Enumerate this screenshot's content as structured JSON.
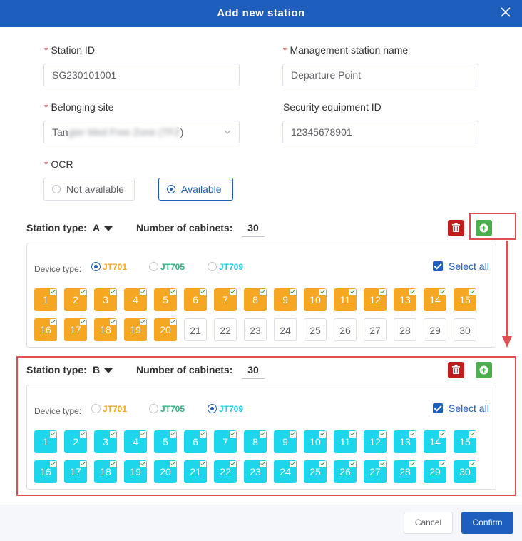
{
  "dialog": {
    "title": "Add new station",
    "close_icon": "close-icon"
  },
  "form": {
    "required_mark": "*",
    "station_id": {
      "label": "Station ID",
      "value": "SG230101001"
    },
    "management_station_name": {
      "label": "Management station name",
      "value": "Departure Point"
    },
    "belonging_site": {
      "label": "Belonging site",
      "value_visible_prefix": "Tan",
      "value_obscured": "gier Med Free Zone (TFZ",
      "value_visible_suffix": ")",
      "icon": "chevron-down-icon"
    },
    "security_equipment_id": {
      "label": "Security equipment ID",
      "value": "12345678901"
    },
    "ocr": {
      "label": "OCR",
      "options": [
        {
          "label": "Not available",
          "selected": false
        },
        {
          "label": "Available",
          "selected": true
        }
      ]
    }
  },
  "stations": [
    {
      "station_type_label": "Station type:",
      "station_type_value": "A",
      "cabinets_label": "Number of cabinets:",
      "cabinets_value": "30",
      "device_type_label": "Device type:",
      "device_options": [
        {
          "label": "JT701",
          "selected": true,
          "color": "#f5a623"
        },
        {
          "label": "JT705",
          "selected": false,
          "color": "#2db37f"
        },
        {
          "label": "JT709",
          "selected": false,
          "color": "#1ec8e0"
        }
      ],
      "select_all_label": "Select all",
      "select_all_checked": true,
      "active_color": "#f5a623",
      "cabinets": [
        {
          "n": "1",
          "on": true
        },
        {
          "n": "2",
          "on": true
        },
        {
          "n": "3",
          "on": true
        },
        {
          "n": "4",
          "on": true
        },
        {
          "n": "5",
          "on": true
        },
        {
          "n": "6",
          "on": true
        },
        {
          "n": "7",
          "on": true
        },
        {
          "n": "8",
          "on": true
        },
        {
          "n": "9",
          "on": true
        },
        {
          "n": "10",
          "on": true
        },
        {
          "n": "11",
          "on": true
        },
        {
          "n": "12",
          "on": true
        },
        {
          "n": "13",
          "on": true
        },
        {
          "n": "14",
          "on": true
        },
        {
          "n": "15",
          "on": true
        },
        {
          "n": "16",
          "on": true
        },
        {
          "n": "17",
          "on": true
        },
        {
          "n": "18",
          "on": true
        },
        {
          "n": "19",
          "on": true
        },
        {
          "n": "20",
          "on": true
        },
        {
          "n": "21",
          "on": false
        },
        {
          "n": "22",
          "on": false
        },
        {
          "n": "23",
          "on": false
        },
        {
          "n": "24",
          "on": false
        },
        {
          "n": "25",
          "on": false
        },
        {
          "n": "26",
          "on": false
        },
        {
          "n": "27",
          "on": false
        },
        {
          "n": "28",
          "on": false
        },
        {
          "n": "29",
          "on": false
        },
        {
          "n": "30",
          "on": false
        }
      ]
    },
    {
      "station_type_label": "Station type:",
      "station_type_value": "B",
      "cabinets_label": "Number of cabinets:",
      "cabinets_value": "30",
      "device_type_label": "Device type:",
      "device_options": [
        {
          "label": "JT701",
          "selected": false,
          "color": "#f5a623"
        },
        {
          "label": "JT705",
          "selected": false,
          "color": "#2db37f"
        },
        {
          "label": "JT709",
          "selected": true,
          "color": "#1ec8e0"
        }
      ],
      "select_all_label": "Select all",
      "select_all_checked": true,
      "active_color": "#1ed6ec",
      "cabinets": [
        {
          "n": "1",
          "on": true
        },
        {
          "n": "2",
          "on": true
        },
        {
          "n": "3",
          "on": true
        },
        {
          "n": "4",
          "on": true
        },
        {
          "n": "5",
          "on": true
        },
        {
          "n": "6",
          "on": true
        },
        {
          "n": "7",
          "on": true
        },
        {
          "n": "8",
          "on": true
        },
        {
          "n": "9",
          "on": true
        },
        {
          "n": "10",
          "on": true
        },
        {
          "n": "11",
          "on": true
        },
        {
          "n": "12",
          "on": true
        },
        {
          "n": "13",
          "on": true
        },
        {
          "n": "14",
          "on": true
        },
        {
          "n": "15",
          "on": true
        },
        {
          "n": "16",
          "on": true
        },
        {
          "n": "17",
          "on": true
        },
        {
          "n": "18",
          "on": true
        },
        {
          "n": "19",
          "on": true
        },
        {
          "n": "20",
          "on": true
        },
        {
          "n": "21",
          "on": true
        },
        {
          "n": "22",
          "on": true
        },
        {
          "n": "23",
          "on": true
        },
        {
          "n": "24",
          "on": true
        },
        {
          "n": "25",
          "on": true
        },
        {
          "n": "26",
          "on": true
        },
        {
          "n": "27",
          "on": true
        },
        {
          "n": "28",
          "on": true
        },
        {
          "n": "29",
          "on": true
        },
        {
          "n": "30",
          "on": true
        }
      ]
    }
  ],
  "footer": {
    "cancel_label": "Cancel",
    "confirm_label": "Confirm"
  },
  "colors": {
    "primary": "#1e5fbe",
    "delete": "#c01e1e",
    "add": "#4cae4c",
    "annotation": "#e05050"
  }
}
